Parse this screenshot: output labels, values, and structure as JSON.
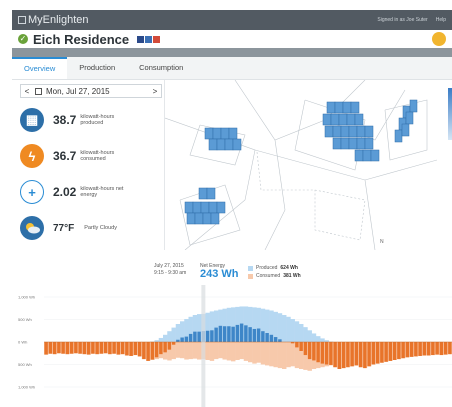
{
  "app": {
    "title": "MyEnlighten",
    "signed_in": "Signed in as Joe Suter",
    "help": "Help"
  },
  "site": {
    "name": "Eich Residence"
  },
  "tabs": [
    {
      "label": "Overview",
      "active": true
    },
    {
      "label": "Production",
      "active": false
    },
    {
      "label": "Consumption",
      "active": false
    }
  ],
  "date_nav": {
    "prev": "<",
    "next": ">",
    "date": "Mon, Jul 27, 2015"
  },
  "stats": [
    {
      "value": "38.7",
      "label": "kilowatt-hours produced",
      "icon": "solar-panel-icon",
      "color": "#2d6fa8"
    },
    {
      "value": "36.7",
      "label": "kilowatt-hours consumed",
      "icon": "plug-icon",
      "color": "#ef8a22"
    },
    {
      "value": "2.02",
      "label": "kilowatt-hours net energy",
      "icon": "plus-icon",
      "color": "#2a8cd4"
    },
    {
      "value": "77°F",
      "label": "Partly Cloudy",
      "icon": "partly-cloudy-icon",
      "color": "#2d6fa8"
    }
  ],
  "net_energy": {
    "date": "July 27, 2015",
    "time": "9:15 - 9:30 am",
    "label": "Net Energy",
    "value": "243 Wh",
    "produced_label": "Produced",
    "produced_value": "624 Wh",
    "consumed_label": "Consumed",
    "consumed_value": "381 Wh"
  },
  "colors": {
    "produced": "#b6d8f2",
    "produced_net": "#3e86c8",
    "consumed": "#f7c9ab",
    "consumed_net": "#e8742a",
    "accent": "#2a8cd4"
  },
  "chart_data": {
    "type": "bar",
    "title": "",
    "ytick_labels": [
      "1,000 Wh",
      "500 Wh",
      "0 Wh",
      "500 Wh",
      "1,000 Wh",
      "1,500 Wh"
    ],
    "ylim": [
      -1500,
      1000
    ],
    "interval": "15 min",
    "selected_index": 37,
    "series": [
      {
        "name": "Produced",
        "values": [
          0,
          0,
          0,
          0,
          0,
          0,
          0,
          0,
          0,
          0,
          0,
          0,
          0,
          0,
          0,
          0,
          0,
          0,
          0,
          0,
          0,
          0,
          0,
          0,
          0,
          10,
          40,
          90,
          160,
          240,
          320,
          400,
          460,
          510,
          560,
          600,
          620,
          624,
          650,
          680,
          700,
          720,
          740,
          760,
          770,
          780,
          790,
          790,
          780,
          770,
          760,
          740,
          720,
          700,
          670,
          640,
          600,
          560,
          510,
          460,
          400,
          330,
          260,
          190,
          130,
          80,
          40,
          10,
          0,
          0,
          0,
          0,
          0,
          0,
          0,
          0,
          0,
          0,
          0,
          0,
          0,
          0,
          0,
          0,
          0,
          0,
          0,
          0,
          0,
          0,
          0,
          0,
          0,
          0,
          0,
          0
        ]
      },
      {
        "name": "Consumed",
        "values": [
          -280,
          -260,
          -270,
          -250,
          -260,
          -270,
          -260,
          -250,
          -260,
          -270,
          -280,
          -260,
          -270,
          -260,
          -250,
          -270,
          -260,
          -280,
          -270,
          -300,
          -310,
          -290,
          -320,
          -380,
          -420,
          -400,
          -380,
          -360,
          -390,
          -410,
          -380,
          -350,
          -360,
          -390,
          -380,
          -370,
          -390,
          -381,
          -400,
          -420,
          -380,
          -360,
          -390,
          -410,
          -430,
          -400,
          -380,
          -420,
          -450,
          -480,
          -460,
          -500,
          -520,
          -540,
          -560,
          -580,
          -600,
          -560,
          -540,
          -580,
          -600,
          -620,
          -640,
          -600,
          -580,
          -560,
          -540,
          -520,
          -560,
          -600,
          -580,
          -560,
          -540,
          -520,
          -560,
          -580,
          -540,
          -500,
          -480,
          -460,
          -440,
          -420,
          -400,
          -380,
          -360,
          -340,
          -330,
          -320,
          -310,
          -300,
          -300,
          -290,
          -280,
          -290,
          -280,
          -270
        ]
      }
    ]
  }
}
